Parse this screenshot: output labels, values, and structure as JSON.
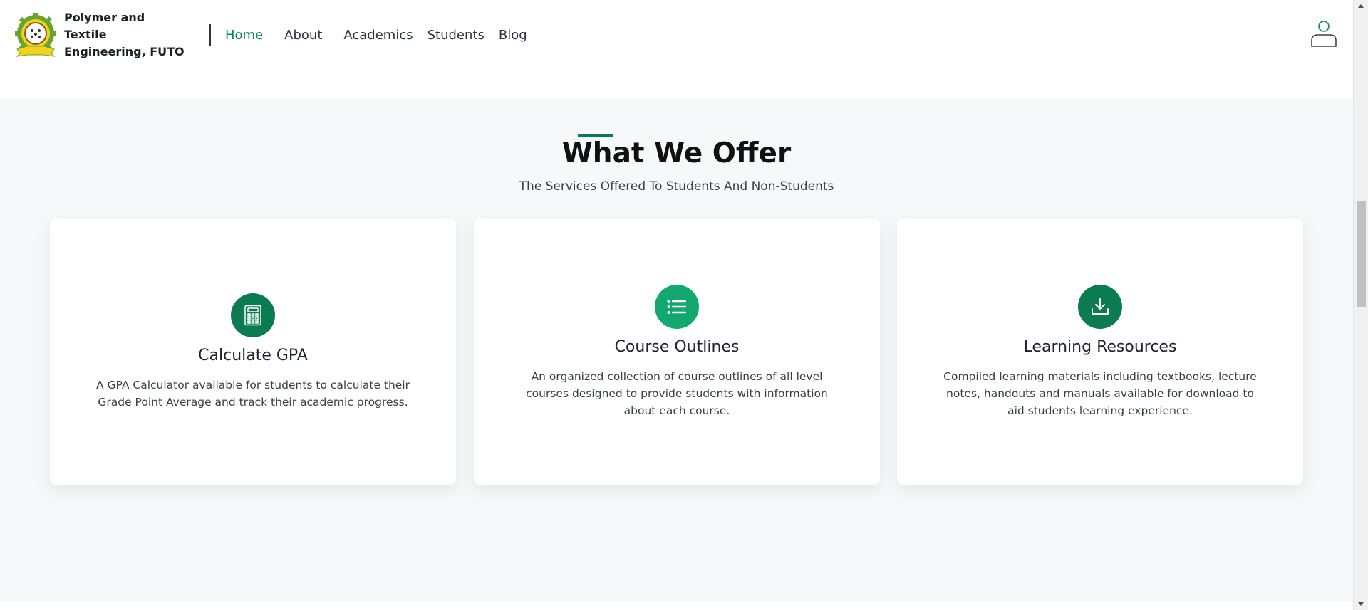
{
  "header": {
    "brand_name": "Polymer and Textile Engineering, FUTO",
    "nav": [
      {
        "label": "Home",
        "active": true
      },
      {
        "label": "About"
      },
      {
        "label": "Academics"
      },
      {
        "label": "Students"
      },
      {
        "label": "Blog"
      }
    ],
    "user_icon": "user-icon"
  },
  "section": {
    "title": "What We Offer",
    "subtitle": "The Services Offered To Students And Non-Students",
    "accent_color": "#0c7a50"
  },
  "cards": [
    {
      "icon": "calculator-icon",
      "title": "Calculate GPA",
      "description": "A GPA Calculator available for students to calculate their Grade Point Average and track their academic progress.",
      "icon_color": "#0b7c52"
    },
    {
      "icon": "list-icon",
      "title": "Course Outlines",
      "description": "An organized collection of course outlines of all level courses designed to provide students with information about each course.",
      "icon_color": "#12a870"
    },
    {
      "icon": "download-icon",
      "title": "Learning Resources",
      "description": "Compiled learning materials including textbooks, lecture notes, handouts and manuals available for download to aid students learning experience.",
      "icon_color": "#0b7c52"
    }
  ]
}
